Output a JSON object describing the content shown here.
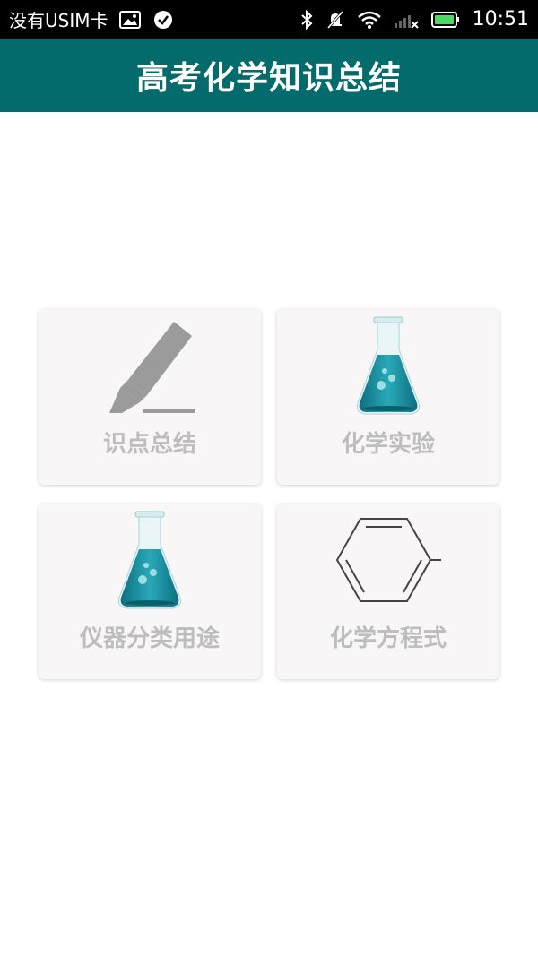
{
  "status_bar": {
    "carrier": "没有USIM卡",
    "time": "10:51",
    "icons_left": [
      "gallery-icon",
      "check-circle-icon"
    ],
    "icons_right": [
      "bluetooth-icon",
      "mute-icon",
      "wifi-icon",
      "signal-icon",
      "battery-icon"
    ]
  },
  "header": {
    "title": "高考化学知识总结",
    "background": "#036b6c"
  },
  "menu": {
    "items": [
      {
        "label": "识点总结",
        "icon": "highlighter-icon"
      },
      {
        "label": "化学实验",
        "icon": "flask-icon"
      },
      {
        "label": "仪器分类用途",
        "icon": "flask-icon"
      },
      {
        "label": "化学方程式",
        "icon": "benzene-ring-icon"
      }
    ]
  },
  "colors": {
    "card_background": "#f8f6f6",
    "label_text": "#bdbdbd",
    "flask_liquid": "#1f9bab"
  }
}
